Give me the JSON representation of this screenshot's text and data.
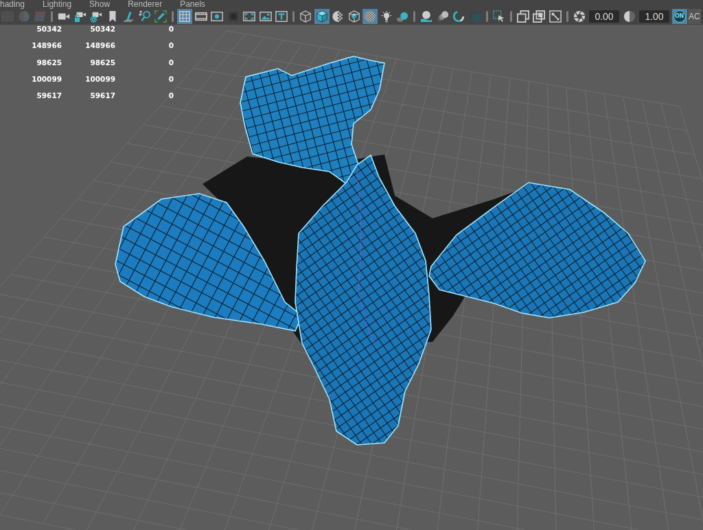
{
  "menu_bar": {
    "items": [
      "hading",
      "Lighting",
      "Show",
      "Renderer",
      "Panels"
    ]
  },
  "toolbar": {
    "items": [
      {
        "kind": "button",
        "selected": false
      },
      {
        "kind": "button",
        "selected": false
      },
      {
        "kind": "button",
        "selected": false
      },
      {
        "kind": "separator"
      },
      {
        "kind": "button",
        "selected": false
      },
      {
        "kind": "button",
        "selected": false
      },
      {
        "kind": "button",
        "selected": false
      },
      {
        "kind": "button",
        "selected": false
      },
      {
        "kind": "button",
        "selected": false
      },
      {
        "kind": "button",
        "selected": false
      },
      {
        "kind": "button",
        "selected": false
      },
      {
        "kind": "separator"
      },
      {
        "kind": "button",
        "selected": true
      },
      {
        "kind": "button",
        "selected": false
      },
      {
        "kind": "button",
        "selected": false
      },
      {
        "kind": "button",
        "selected": false
      },
      {
        "kind": "button",
        "selected": false
      },
      {
        "kind": "button",
        "selected": false
      },
      {
        "kind": "button",
        "selected": false
      },
      {
        "kind": "separator"
      },
      {
        "kind": "button",
        "selected": false
      },
      {
        "kind": "button",
        "selected": true
      },
      {
        "kind": "button",
        "selected": false
      },
      {
        "kind": "button",
        "selected": false
      },
      {
        "kind": "button",
        "selected": true
      },
      {
        "kind": "button",
        "selected": false
      },
      {
        "kind": "button",
        "selected": false
      },
      {
        "kind": "separator"
      },
      {
        "kind": "button",
        "selected": false
      },
      {
        "kind": "button",
        "selected": false
      },
      {
        "kind": "button",
        "selected": false
      },
      {
        "kind": "button",
        "selected": false
      },
      {
        "kind": "separator"
      },
      {
        "kind": "button",
        "selected": false
      },
      {
        "kind": "separator"
      },
      {
        "kind": "button",
        "selected": false
      },
      {
        "kind": "button",
        "selected": false
      },
      {
        "kind": "button",
        "selected": false
      },
      {
        "kind": "separator"
      },
      {
        "kind": "button",
        "selected": false
      },
      {
        "kind": "field",
        "value": "0.00"
      },
      {
        "kind": "button",
        "selected": false
      },
      {
        "kind": "field",
        "value": "1.00"
      },
      {
        "kind": "toggle",
        "label": "ON",
        "selected": true
      },
      {
        "kind": "label",
        "text": "AC"
      }
    ]
  },
  "stats": {
    "rows": [
      {
        "column_1": "50342",
        "column_2": "50342",
        "column_3": "0"
      },
      {
        "column_1": "148966",
        "column_2": "148966",
        "column_3": "0"
      },
      {
        "column_1": "98625",
        "column_2": "98625",
        "column_3": "0"
      },
      {
        "column_1": "100099",
        "column_2": "100099",
        "column_3": "0"
      },
      {
        "column_1": "59617",
        "column_2": "59617",
        "column_3": "0"
      }
    ]
  }
}
